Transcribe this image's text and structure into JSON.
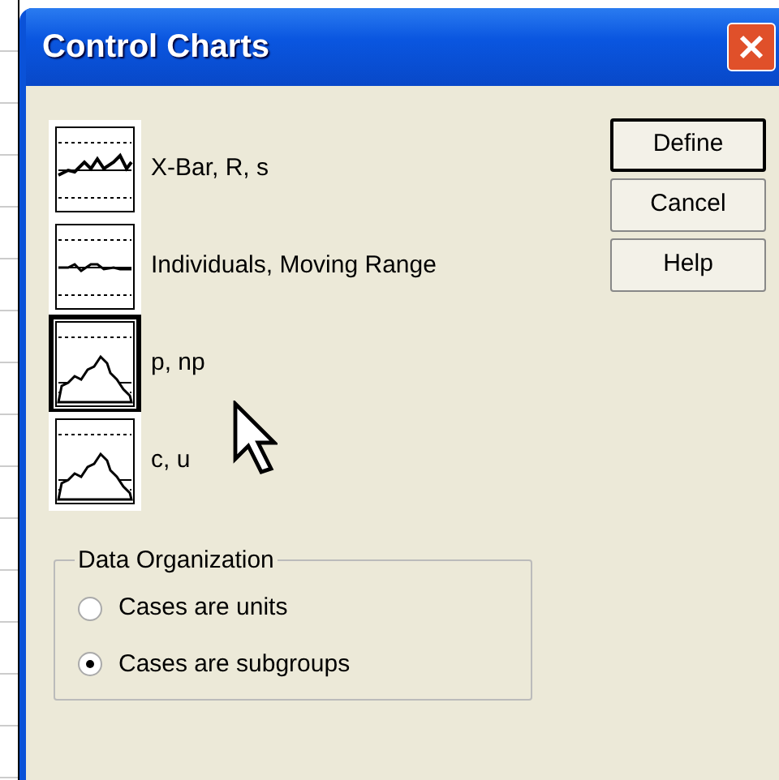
{
  "window": {
    "title": "Control Charts"
  },
  "chart_types": [
    {
      "label": "X-Bar, R, s",
      "kind": "xbar",
      "selected": false
    },
    {
      "label": "Individuals, Moving Range",
      "kind": "individuals",
      "selected": false
    },
    {
      "label": "p, np",
      "kind": "proportion",
      "selected": true
    },
    {
      "label": "c, u",
      "kind": "count",
      "selected": false
    }
  ],
  "buttons": [
    {
      "label": "Define",
      "default": true
    },
    {
      "label": "Cancel",
      "default": false
    },
    {
      "label": "Help",
      "default": false
    }
  ],
  "data_organization": {
    "title": "Data Organization",
    "options": [
      {
        "label": "Cases are units",
        "selected": false
      },
      {
        "label": "Cases are subgroups",
        "selected": true
      }
    ]
  }
}
